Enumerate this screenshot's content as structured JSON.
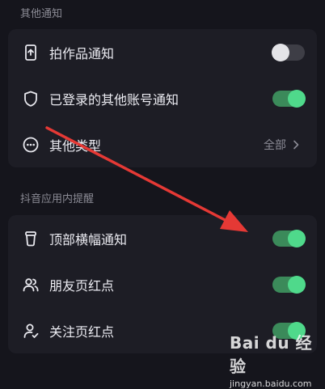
{
  "sections": [
    {
      "title": "其他通知",
      "rows": [
        {
          "label": "拍作品通知",
          "icon": "phone-upload-icon",
          "control": "toggle",
          "enabled": false
        },
        {
          "label": "已登录的其他账号通知",
          "icon": "shield-icon",
          "control": "toggle",
          "enabled": true
        },
        {
          "label": "其他类型",
          "icon": "more-circle-icon",
          "control": "select",
          "value": "全部"
        }
      ]
    },
    {
      "title": "抖音应用内提醒",
      "rows": [
        {
          "label": "顶部横幅通知",
          "icon": "banner-cup-icon",
          "control": "toggle",
          "enabled": true
        },
        {
          "label": "朋友页红点",
          "icon": "friends-icon",
          "control": "toggle",
          "enabled": true
        },
        {
          "label": "关注页红点",
          "icon": "follow-user-icon",
          "control": "toggle",
          "enabled": true
        }
      ]
    }
  ],
  "watermark": {
    "brand": "Bai du 经验",
    "site": "jingyan.baidu.com"
  },
  "colors": {
    "background": "#15151c",
    "card": "#1d1d25",
    "toggle_on": "#4fd98b",
    "annotation_arrow": "#e53935"
  }
}
